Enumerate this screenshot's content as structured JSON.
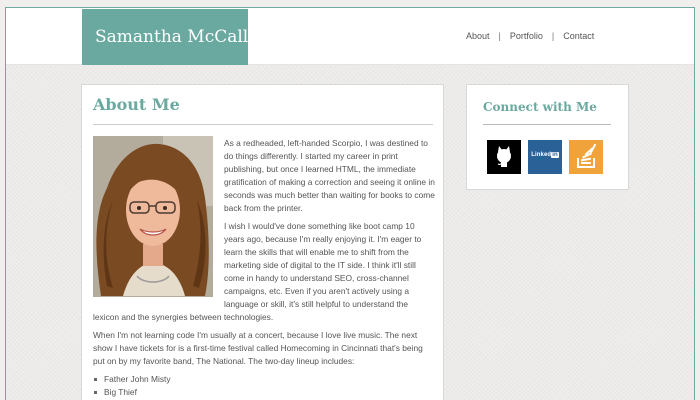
{
  "site": {
    "name": "Samantha McCall"
  },
  "nav": {
    "items": [
      "About",
      "Portfolio",
      "Contact"
    ],
    "separator": "|"
  },
  "about": {
    "title": "About Me",
    "paragraphs": [
      "As a redheaded, left-handed Scorpio, I was destined to do things differently. I started my career in print publishing, but once I learned HTML, the immediate gratification of making a correction and seeing it online in seconds was much better than waiting for books to come back from the printer.",
      "I wish I would've done something like boot camp 10 years ago, because I'm really enjoying it. I'm eager to learn the skills that will enable me to shift from the marketing side of digital to the IT side. I think it'll still come in handy to understand SEO, cross-channel campaigns, etc. Even if you aren't actively using a language or skill, it's still helpful to understand the lexicon and the synergies between technologies.",
      "When I'm not learning code I'm usually at a concert, because I love live music. The next show I have tickets for is a first-time festival called Homecoming in Cincinnati that's being put on by my favorite band, The National. The two-day lineup includes:"
    ],
    "lineup": [
      "Father John Misty",
      "Big Thief"
    ]
  },
  "connect": {
    "title": "Connect with Me",
    "links": [
      {
        "name": "github",
        "icon": "github-icon"
      },
      {
        "name": "linkedin",
        "icon": "linkedin-icon",
        "label_main": "Linked",
        "label_box": "in"
      },
      {
        "name": "stackoverflow",
        "icon": "stackoverflow-icon"
      }
    ]
  },
  "colors": {
    "brand": "#69a99f",
    "linkedin": "#2a6197",
    "stackoverflow": "#f0a33a",
    "github": "#000000"
  }
}
